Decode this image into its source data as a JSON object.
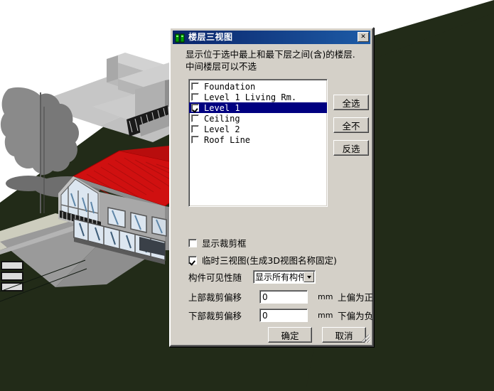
{
  "dialog": {
    "title": "楼层三视图",
    "icon": "building-icon",
    "close_label": "✕",
    "description_line1": "显示位于选中最上和最下层之间(含)的楼层.",
    "description_line2": "中间楼层可以不选",
    "listbox": {
      "items": [
        {
          "label": "Foundation",
          "checked": false,
          "selected": false
        },
        {
          "label": "Level 1 Living Rm.",
          "checked": false,
          "selected": false
        },
        {
          "label": "Level 1",
          "checked": true,
          "selected": true
        },
        {
          "label": "Ceiling",
          "checked": false,
          "selected": false
        },
        {
          "label": "Level 2",
          "checked": false,
          "selected": false
        },
        {
          "label": "Roof Line",
          "checked": false,
          "selected": false
        }
      ]
    },
    "side_buttons": {
      "select_all": "全选",
      "select_none": "全不",
      "invert": "反选"
    },
    "options": {
      "show_clip_box_label": "显示裁剪框",
      "show_clip_box_checked": false,
      "temp_view_label": "临时三视图(生成3D视图名称固定)",
      "temp_view_checked": true
    },
    "visibility": {
      "label": "构件可见性随",
      "selected": "显示所有构件",
      "options": [
        "显示所有构件"
      ]
    },
    "offsets": {
      "top": {
        "label": "上部裁剪偏移",
        "value": "0",
        "unit": "mm",
        "note": "上偏为正"
      },
      "bottom": {
        "label": "下部裁剪偏移",
        "value": "0",
        "unit": "mm",
        "note": "下偏为负"
      }
    },
    "footer": {
      "ok": "确定",
      "cancel": "取消"
    }
  },
  "scene": {
    "name": "3d-architectural-model",
    "colors": {
      "sky": "#ffffff",
      "terrain": "#222b18",
      "concrete_light": "#c8c8c8",
      "concrete_mid": "#b4b4b4",
      "concrete_dark": "#8c8c8c",
      "roof_red": "#d01010",
      "glass": "#dce6f0",
      "tree": "#8a8a8a",
      "path": "#cdcdbe"
    }
  },
  "theme": {
    "dialog_face": "#d4d0c8",
    "title_bar_start": "#0a246a",
    "title_bar_end": "#1d5ba6",
    "selection": "#000080"
  }
}
